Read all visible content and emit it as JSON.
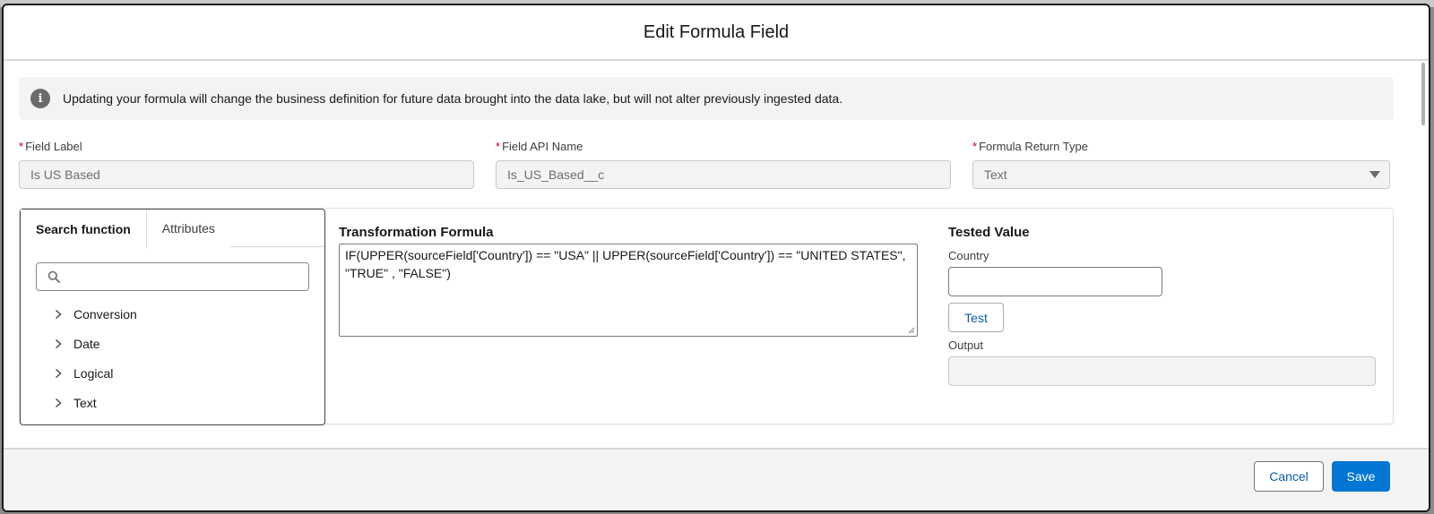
{
  "modal": {
    "title": "Edit Formula Field"
  },
  "info": {
    "icon": "info-icon",
    "text": "Updating your formula will change the business definition for future data brought into the data lake, but will not alter previously ingested data."
  },
  "fields": {
    "label": {
      "label": "Field Label",
      "value": "Is US Based"
    },
    "api_name": {
      "label": "Field API Name",
      "value": "Is_US_Based__c"
    },
    "return_type": {
      "label": "Formula Return Type",
      "value": "Text"
    }
  },
  "function_panel": {
    "tabs": [
      {
        "label": "Search function",
        "active": true
      },
      {
        "label": "Attributes",
        "active": false
      }
    ],
    "search": {
      "placeholder": "",
      "value": ""
    },
    "categories": [
      {
        "label": "Conversion"
      },
      {
        "label": "Date"
      },
      {
        "label": "Logical"
      },
      {
        "label": "Text"
      }
    ]
  },
  "formula": {
    "title": "Transformation Formula",
    "value": "IF(UPPER(sourceField['Country']) == \"USA\" || UPPER(sourceField['Country']) == \"UNITED STATES\",\n\"TRUE\" , \"FALSE\")"
  },
  "tested": {
    "title": "Tested Value",
    "country_label": "Country",
    "country_value": "",
    "test_label": "Test",
    "output_label": "Output",
    "output_value": ""
  },
  "footer": {
    "cancel_label": "Cancel",
    "save_label": "Save"
  },
  "colors": {
    "brand": "#0176d3",
    "link": "#0b5cab",
    "required": "#ba0517"
  }
}
